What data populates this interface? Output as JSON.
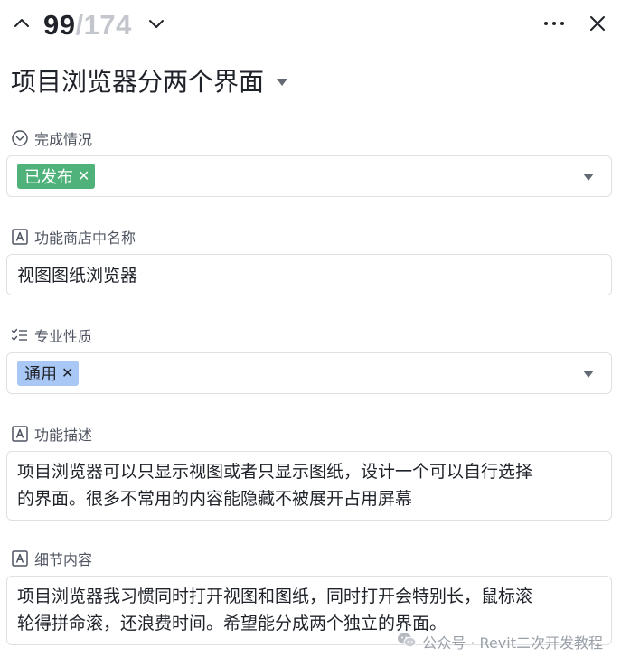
{
  "nav": {
    "current": "99",
    "separator": "/",
    "total": "174"
  },
  "record": {
    "title": "项目浏览器分两个界面"
  },
  "fields": {
    "status": {
      "label": "完成情况",
      "icon": "circle-chevron-down-icon",
      "tag": "已发布",
      "tag_color": "#4fb27a"
    },
    "store_name": {
      "label": "功能商店中名称",
      "icon": "text-field-icon",
      "value": "视图图纸浏览器"
    },
    "discipline": {
      "label": "专业性质",
      "icon": "checklist-icon",
      "tag": "通用",
      "tag_color": "#a9c8f5"
    },
    "description": {
      "label": "功能描述",
      "icon": "text-field-icon",
      "lines": [
        "项目浏览器可以只显示视图或者只显示图纸，设计一个可以自行选择",
        "的界面。很多不常用的内容能隐藏不被展开占用屏幕"
      ]
    },
    "details": {
      "label": "细节内容",
      "icon": "text-field-icon",
      "lines": [
        "项目浏览器我习惯同时打开视图和图纸，同时打开会特别长，鼠标滚",
        "轮得拼命滚，还浪费时间。希望能分成两个独立的界面。"
      ]
    }
  },
  "watermark": {
    "text": "公众号 · Revit二次开发教程"
  }
}
